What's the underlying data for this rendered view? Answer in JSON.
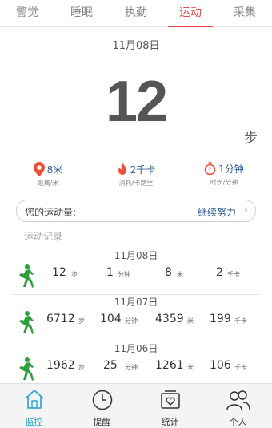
{
  "tabs": [
    "警觉",
    "睡眠",
    "执勤",
    "运动",
    "采集"
  ],
  "active_tab": "运动",
  "summary": {
    "date": "11月08日",
    "steps": "12",
    "step_unit": "步",
    "stats": [
      {
        "icon": "location-pin-icon",
        "value": "8米",
        "label": "距离/米",
        "color": "#e8503a"
      },
      {
        "icon": "flame-icon",
        "value": "2千卡",
        "label": "消耗/卡路里",
        "color": "#e8503a"
      },
      {
        "icon": "timer-icon",
        "value": "1分钟",
        "label": "时长/分钟",
        "color": "#e8503a"
      }
    ]
  },
  "motion_bar": {
    "label": "您的运动量:",
    "status": "继续努力",
    "chevron": "›"
  },
  "records_title": "运动记录",
  "records": [
    {
      "date": "11月08日",
      "steps": "12",
      "steps_unit": "步",
      "minutes": "1",
      "minutes_unit": "分钟",
      "meters": "8",
      "meters_unit": "米",
      "kcal": "2",
      "kcal_unit": "千卡"
    },
    {
      "date": "11月07日",
      "steps": "6712",
      "steps_unit": "步",
      "minutes": "104",
      "minutes_unit": "分钟",
      "meters": "4359",
      "meters_unit": "米",
      "kcal": "199",
      "kcal_unit": "千卡"
    },
    {
      "date": "11月06日",
      "steps": "1962",
      "steps_unit": "步",
      "minutes": "25",
      "minutes_unit": "分钟",
      "meters": "1261",
      "meters_unit": "米",
      "kcal": "106",
      "kcal_unit": "千卡"
    }
  ],
  "bottom_nav": [
    {
      "icon": "home-icon",
      "label": "监控"
    },
    {
      "icon": "clock-icon",
      "label": "提醒"
    },
    {
      "icon": "stats-heart-icon",
      "label": "统计"
    },
    {
      "icon": "users-icon",
      "label": "个人"
    }
  ],
  "colors": {
    "accent": "#e24b4b",
    "runner": "#2e9e3e",
    "nav_active": "#29a3c9",
    "stat_value": "#2f5f8f"
  }
}
